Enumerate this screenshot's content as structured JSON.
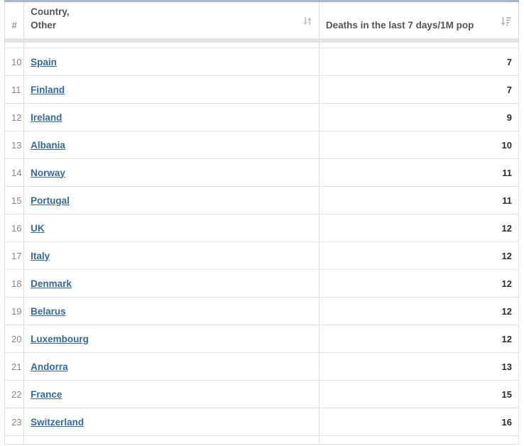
{
  "table": {
    "columns": [
      {
        "key": "rank",
        "label": "#",
        "sort_icon": "none"
      },
      {
        "key": "country",
        "label": "Country,\nOther",
        "sort_icon": "sort-both-icon"
      },
      {
        "key": "deaths7d",
        "label": "Deaths in the last 7 days/1M pop",
        "sort_icon": "sort-amount-asc-icon"
      }
    ],
    "colors": {
      "link": "#35699b",
      "header_text": "#555555",
      "rank_text": "#888888",
      "value_text": "#2b2b33",
      "border": "#e0e0e0",
      "top_border": "#a8b6c9",
      "sort_icon": "#c0c0c0"
    },
    "rows": [
      {
        "rank": "10",
        "country": "Spain",
        "value": "7"
      },
      {
        "rank": "11",
        "country": "Finland",
        "value": "7"
      },
      {
        "rank": "12",
        "country": "Ireland",
        "value": "9"
      },
      {
        "rank": "13",
        "country": "Albania",
        "value": "10"
      },
      {
        "rank": "14",
        "country": "Norway",
        "value": "11"
      },
      {
        "rank": "15",
        "country": "Portugal",
        "value": "11"
      },
      {
        "rank": "16",
        "country": "UK",
        "value": "12"
      },
      {
        "rank": "17",
        "country": "Italy",
        "value": "12"
      },
      {
        "rank": "18",
        "country": "Denmark",
        "value": "12"
      },
      {
        "rank": "19",
        "country": "Belarus",
        "value": "12"
      },
      {
        "rank": "20",
        "country": "Luxembourg",
        "value": "12"
      },
      {
        "rank": "21",
        "country": "Andorra",
        "value": "13"
      },
      {
        "rank": "22",
        "country": "France",
        "value": "15"
      },
      {
        "rank": "23",
        "country": "Switzerland",
        "value": "16"
      }
    ]
  },
  "chart_data": {
    "type": "table",
    "title": "Deaths in the last 7 days/1M pop",
    "categories": [
      "Spain",
      "Finland",
      "Ireland",
      "Albania",
      "Norway",
      "Portugal",
      "UK",
      "Italy",
      "Denmark",
      "Belarus",
      "Luxembourg",
      "Andorra",
      "France",
      "Switzerland"
    ],
    "values": [
      7,
      7,
      9,
      10,
      11,
      11,
      12,
      12,
      12,
      12,
      12,
      13,
      15,
      16
    ],
    "ranks": [
      10,
      11,
      12,
      13,
      14,
      15,
      16,
      17,
      18,
      19,
      20,
      21,
      22,
      23
    ],
    "xlabel": "Country, Other",
    "ylabel": "Deaths in the last 7 days/1M pop",
    "sorted_by": "Deaths in the last 7 days/1M pop",
    "sort_direction": "ascending"
  }
}
